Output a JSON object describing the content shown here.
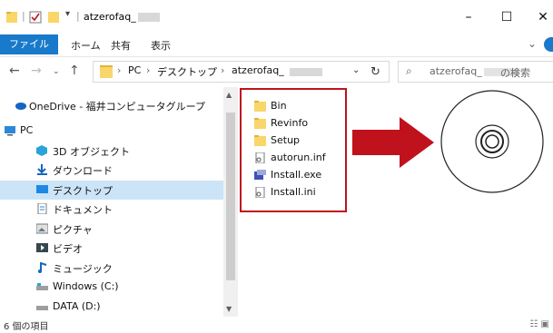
{
  "titlebar": {
    "title": "atzerofaq_",
    "pipe": "|"
  },
  "ribbon": {
    "tabs": [
      "ファイル",
      "ホーム",
      "共有",
      "表示"
    ],
    "expand": "⌄"
  },
  "address": {
    "crumbs": [
      "PC",
      "デスクトップ",
      "atzerofaq_"
    ],
    "sep": "›"
  },
  "search": {
    "prefix": "atzerofaq_",
    "suffix": "の検索"
  },
  "nav": {
    "items": [
      {
        "label": "OneDrive - 福井コンピュータグループ",
        "icon": "cloud-icon"
      },
      {
        "label": "PC",
        "icon": "pc-icon"
      },
      {
        "label": "3D オブジェクト",
        "icon": "cube-icon"
      },
      {
        "label": "ダウンロード",
        "icon": "download-icon"
      },
      {
        "label": "デスクトップ",
        "icon": "desktop-icon",
        "selected": true
      },
      {
        "label": "ドキュメント",
        "icon": "document-icon"
      },
      {
        "label": "ピクチャ",
        "icon": "picture-icon"
      },
      {
        "label": "ビデオ",
        "icon": "video-icon"
      },
      {
        "label": "ミュージック",
        "icon": "music-icon"
      },
      {
        "label": "Windows (C:)",
        "icon": "drive-icon"
      },
      {
        "label": "DATA (D:)",
        "icon": "drive-icon"
      }
    ]
  },
  "files": [
    {
      "name": "Bin",
      "type": "folder"
    },
    {
      "name": "Revinfo",
      "type": "folder"
    },
    {
      "name": "Setup",
      "type": "folder"
    },
    {
      "name": "autorun.inf",
      "type": "inf"
    },
    {
      "name": "Install.exe",
      "type": "exe"
    },
    {
      "name": "Install.ini",
      "type": "ini"
    }
  ],
  "status": {
    "text": "6 個の項目"
  },
  "colors": {
    "accent": "#1979ca",
    "highlight": "#c0121c",
    "selection": "#cce4f7"
  }
}
